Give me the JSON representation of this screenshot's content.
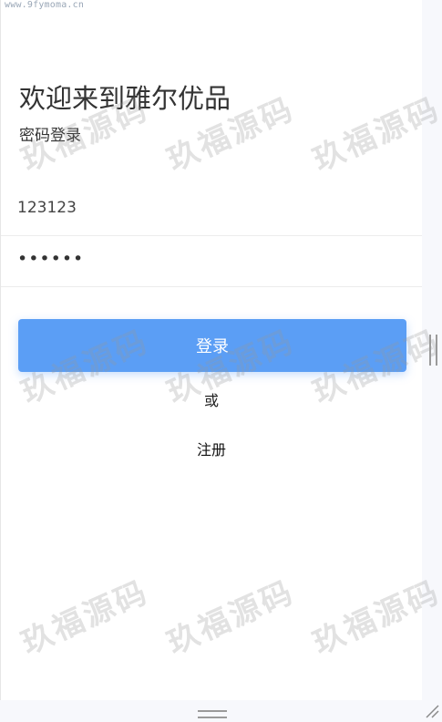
{
  "site_url": "www.9fymoma.cn",
  "header": {
    "title": "欢迎来到雅尔优品",
    "subtitle": "密码登录"
  },
  "form": {
    "username_value": "123123",
    "password_value": "••••••",
    "login_label": "登录",
    "or_label": "或",
    "register_label": "注册"
  },
  "watermark_text": "玖福源码",
  "colors": {
    "accent": "#5b9ef5",
    "background": "#f7f8fc",
    "panel": "#ffffff"
  },
  "icons": [
    "scroll-handle-icon",
    "bottom-handle-icon",
    "resize-grip-icon"
  ]
}
